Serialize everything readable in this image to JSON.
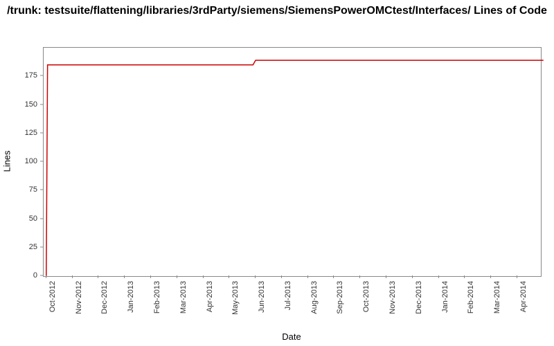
{
  "chart_data": {
    "type": "line",
    "title": "/trunk: testsuite/flattening/libraries/3rdParty/siemens/SiemensPowerOMCtest/Interfaces/ Lines of Code",
    "xlabel": "Date",
    "ylabel": "Lines",
    "ylim": [
      0,
      200
    ],
    "y_ticks": [
      0,
      25,
      50,
      75,
      100,
      125,
      150,
      175
    ],
    "x_categories": [
      "Oct-2012",
      "Nov-2012",
      "Dec-2012",
      "Jan-2013",
      "Feb-2013",
      "Mar-2013",
      "Apr-2013",
      "May-2013",
      "Jun-2013",
      "Jul-2013",
      "Aug-2013",
      "Sep-2013",
      "Oct-2013",
      "Nov-2013",
      "Dec-2013",
      "Jan-2014",
      "Feb-2014",
      "Mar-2014",
      "Apr-2014"
    ],
    "series": [
      {
        "name": "Lines of Code",
        "color": "#cc0000",
        "points": [
          {
            "x": "Oct-2012",
            "frac": 0.0,
            "y": 0
          },
          {
            "x": "Oct-2012",
            "frac": 0.05,
            "y": 185
          },
          {
            "x": "May-2013",
            "frac": 0.9,
            "y": 185
          },
          {
            "x": "Jun-2013",
            "frac": 0.0,
            "y": 189
          },
          {
            "x": "Apr-2014",
            "frac": 1.0,
            "y": 189
          }
        ]
      }
    ]
  }
}
